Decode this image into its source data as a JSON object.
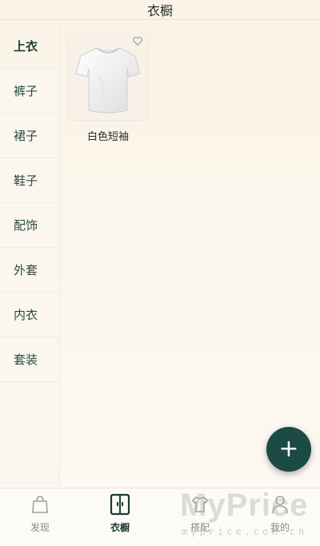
{
  "header": {
    "title": "衣橱"
  },
  "sidebar": {
    "items": [
      {
        "label": "上衣",
        "active": true
      },
      {
        "label": "裤子"
      },
      {
        "label": "裙子"
      },
      {
        "label": "鞋子"
      },
      {
        "label": "配饰"
      },
      {
        "label": "外套"
      },
      {
        "label": "内衣"
      },
      {
        "label": "套装"
      }
    ]
  },
  "content": {
    "items": [
      {
        "label": "白色短袖",
        "image": "white-tshirt",
        "favorite": false
      }
    ]
  },
  "fab": {
    "symbol": "+"
  },
  "tabbar": {
    "tabs": [
      {
        "label": "发现",
        "icon": "bag-icon"
      },
      {
        "label": "衣橱",
        "icon": "wardrobe-icon",
        "active": true
      },
      {
        "label": "搭配",
        "icon": "hanger-shirt-icon"
      },
      {
        "label": "我的",
        "icon": "person-icon"
      }
    ]
  },
  "watermark": {
    "brand": "MyPrice",
    "url": "myprice.com.cn"
  },
  "colors": {
    "accent": "#1c4a45",
    "background": "#fbf6ec"
  }
}
